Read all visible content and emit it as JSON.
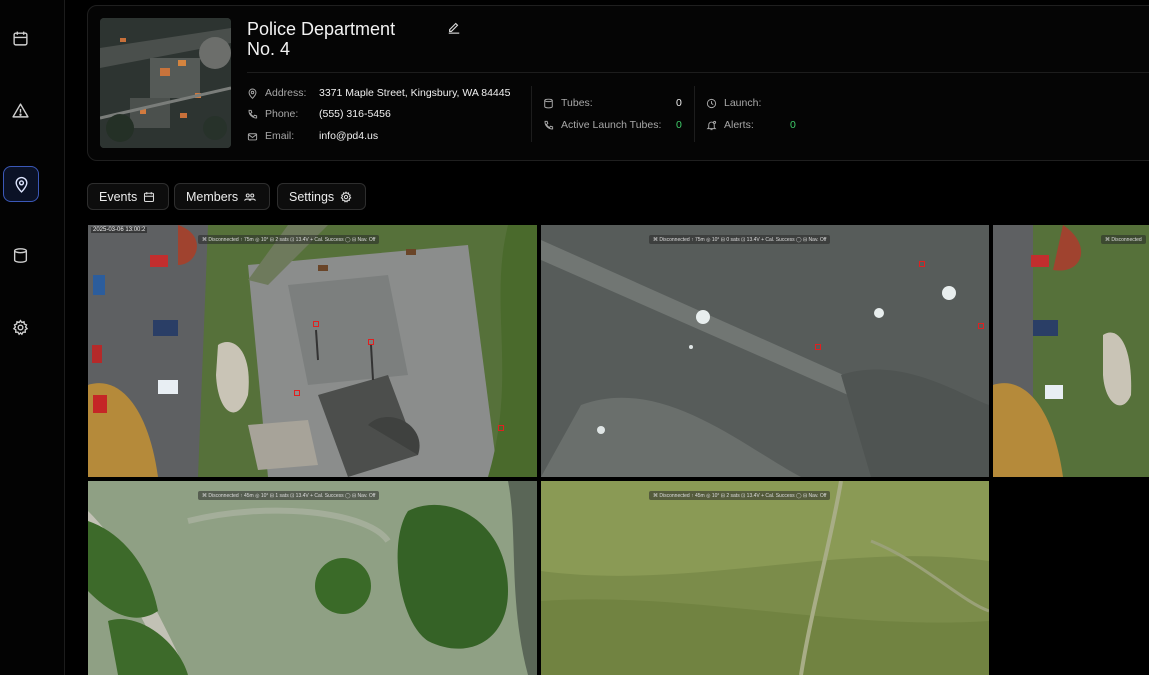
{
  "sidebar": {
    "items": [
      {
        "icon": "calendar-icon"
      },
      {
        "icon": "alert-triangle-icon"
      },
      {
        "icon": "map-pin-icon",
        "active": true
      },
      {
        "icon": "cylinder-icon"
      },
      {
        "icon": "gear-icon"
      }
    ]
  },
  "station": {
    "title": "Police Department No. 4",
    "address_label": "Address:",
    "address": "3371 Maple Street, Kingsbury, WA 84445",
    "phone_label": "Phone:",
    "phone": "(555) 316-5456",
    "email_label": "Email:",
    "email": "info@pd4.us",
    "tubes_label": "Tubes:",
    "tubes": "0",
    "active_tubes_label": "Active Launch Tubes:",
    "active_tubes": "0",
    "launch_label": "Launch:",
    "launch": "",
    "alerts_label": "Alerts:",
    "alerts": "0"
  },
  "tabs": [
    {
      "label": "Events",
      "icon": "calendar-icon"
    },
    {
      "label": "Members",
      "icon": "users-icon"
    },
    {
      "label": "Settings",
      "icon": "gear-icon"
    }
  ],
  "feeds": [
    {
      "timestamp": "2025-03-06 13:00:2",
      "status": "⌘ Disconnected   ↑ 75m   ◎ 10°   ⊟ 2 sats   ⊡ 13.4V   + Cal. Success   ◯ ⊟ Nav. Off"
    },
    {
      "timestamp": "",
      "status": "⌘ Disconnected   ↑ 75m   ◎ 10°   ⊟ 0 sats   ⊡ 13.4V   + Cal. Success   ◯ ⊟ Nav. Off"
    },
    {
      "timestamp": "",
      "status": "⌘ Disconnected"
    },
    {
      "timestamp": "",
      "status": "⌘ Disconnected   ↑ 45m   ◎ 10°   ⊟ 1 sats   ⊡ 13.4V   + Cal. Success   ◯ ⊟ Nav. Off"
    },
    {
      "timestamp": "",
      "status": "⌘ Disconnected   ↑ 45m   ◎ 10°   ⊟ 2 sats   ⊡ 13.4V   + Cal. Success   ◯ ⊟ Nav. Off"
    }
  ]
}
